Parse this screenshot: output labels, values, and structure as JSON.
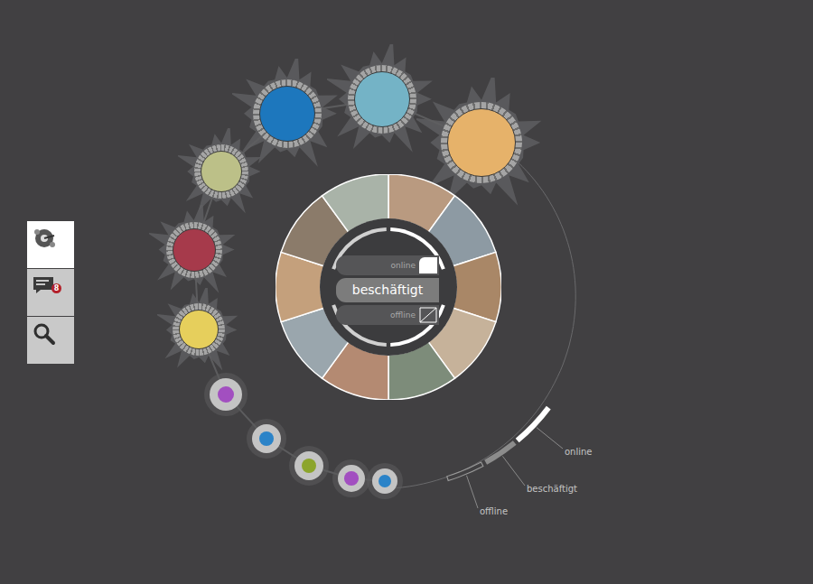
{
  "toolbar": [
    {
      "kind": "contacts",
      "selected": true
    },
    {
      "kind": "messages",
      "selected": false,
      "badge": "8"
    },
    {
      "kind": "search",
      "selected": false
    }
  ],
  "status_menu": [
    {
      "label": "online",
      "kind": "online",
      "selected": false
    },
    {
      "label": "beschäftigt",
      "kind": "busy",
      "selected": true
    },
    {
      "label": "offline",
      "kind": "offline",
      "selected": false
    }
  ],
  "legend": [
    {
      "label": "online",
      "kind": "online"
    },
    {
      "label": "beschäftigt",
      "kind": "busy"
    },
    {
      "label": "offline",
      "kind": "offline"
    }
  ],
  "contacts": [
    {
      "color": "#e6b26a",
      "kind": "burst"
    },
    {
      "color": "#74b3c6",
      "kind": "burst"
    },
    {
      "color": "#1d77bd",
      "kind": "burst"
    },
    {
      "color": "#bcc088",
      "kind": "burst"
    },
    {
      "color": "#a63a4b",
      "kind": "burst"
    },
    {
      "color": "#e6cf5c",
      "kind": "burst"
    },
    {
      "color": "#a24fc0",
      "kind": "plain"
    },
    {
      "color": "#2b83c8",
      "kind": "plain"
    },
    {
      "color": "#8ca52c",
      "kind": "plain"
    },
    {
      "color": "#a24fc0",
      "kind": "plain"
    },
    {
      "color": "#2b83c8",
      "kind": "plain"
    }
  ]
}
